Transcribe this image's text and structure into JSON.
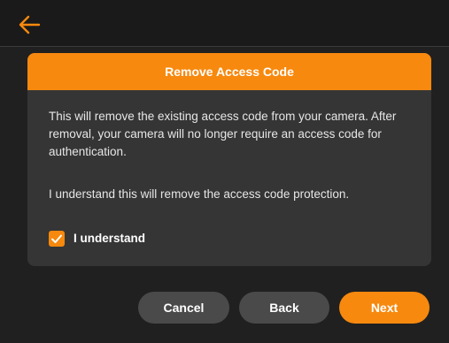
{
  "colors": {
    "accent": "#f7890e",
    "background": "#202020",
    "card": "#353535",
    "secondary_button": "#4a4a4a"
  },
  "topbar": {
    "back_icon": "arrow-left-icon"
  },
  "dialog": {
    "title": "Remove Access Code",
    "description": "This will remove the existing access code from your camera. After removal, your camera will no longer require an access code for authentication.",
    "confirm_text": "I understand this will remove the access code protection.",
    "checkbox": {
      "label": "I understand",
      "checked": true,
      "icon": "checkmark-icon"
    }
  },
  "footer": {
    "cancel_label": "Cancel",
    "back_label": "Back",
    "next_label": "Next"
  }
}
